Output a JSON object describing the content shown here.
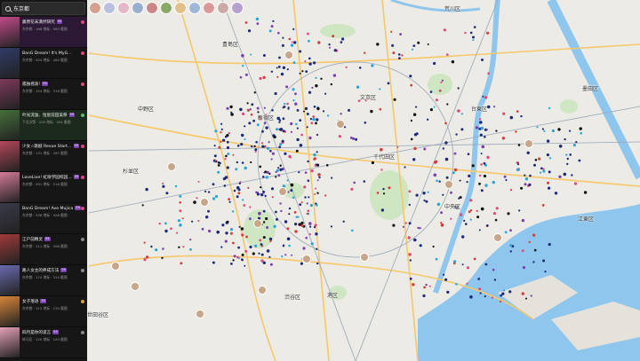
{
  "search": {
    "value": "东京都",
    "icon": "search-icon"
  },
  "list": [
    {
      "title": "藤原花未満然研究",
      "badge": "55",
      "sub": "东京都 · 166 地标 · 583 截图",
      "color": "#c24a8a",
      "dot": "#e0487a",
      "state": "active"
    },
    {
      "title": "BanG Dream! It's MyG…",
      "badge": "",
      "sub": "东京都 · 454 地标 · 484 截图",
      "color": "#2f3b66",
      "dot": "#e0487a",
      "state": ""
    },
    {
      "title": "孤独摇滚!",
      "badge": "55",
      "sub": "东京都 · 154 地标 · 318 截图",
      "color": "#7d3a5a",
      "dot": "#e0487a",
      "state": ""
    },
    {
      "title": "叶光流溢、恒星前田美祭",
      "badge": "55",
      "sub": "下北沢等 · 200 地标 · 254 截图",
      "color": "#456f3a",
      "dot": "#5fbf6a",
      "state": "green"
    },
    {
      "title": "少女☆歌剧 Revue Start…",
      "badge": "55",
      "sub": "东京都 · 131 地标 · 287 截图",
      "color": "#b5475a",
      "dot": "#e0487a",
      "state": ""
    },
    {
      "title": "LoveLive! 虹咲学园校园…",
      "badge": "55",
      "sub": "东京都 · 261 地标 · 518 截图",
      "color": "#d47b9a",
      "dot": "#e0487a",
      "state": ""
    },
    {
      "title": "BanG Dream! Ave Mujica",
      "badge": "55",
      "sub": "东京都 · 336 地标 · 426 截图",
      "color": "#3a3a4a",
      "dot": "#e0487a",
      "state": ""
    },
    {
      "title": "江户前精灵",
      "badge": "55",
      "sub": "东京都 · 111 地标 · 306 截图",
      "color": "#a13a3a",
      "dot": "#888888",
      "state": ""
    },
    {
      "title": "路人女主的养成方法",
      "badge": "55",
      "sub": "东京都 · 174 地标 · 314 截图",
      "color": "#6a6ab0",
      "dot": "#888888",
      "state": ""
    },
    {
      "title": "女子落语",
      "badge": "55",
      "sub": "东京都 · 113 地标 · 130 截图",
      "color": "#d9863a",
      "dot": "#d9a23a",
      "state": ""
    },
    {
      "title": "四月是你的谎言",
      "badge": "55",
      "sub": "练马区 · 120 地标 · 163 截图",
      "color": "#e4a0b8",
      "dot": "#888888",
      "state": ""
    }
  ],
  "topbar_avatars": [
    "#d5a090",
    "#b9c0e0",
    "#e6b7c9",
    "#9ab0d0",
    "#c88",
    "#8a6",
    "#e3c08a",
    "#a0b8d8",
    "#d99",
    "#caa",
    "#b8a0d0"
  ],
  "map_labels": [
    {
      "text": "荒川区",
      "kind": ""
    },
    {
      "text": "豊島区",
      "kind": ""
    },
    {
      "text": "文京区",
      "kind": ""
    },
    {
      "text": "台東区",
      "kind": ""
    },
    {
      "text": "墨田区",
      "kind": ""
    },
    {
      "text": "中野区",
      "kind": ""
    },
    {
      "text": "新宿区",
      "kind": ""
    },
    {
      "text": "杉並区",
      "kind": ""
    },
    {
      "text": "千代田区",
      "kind": ""
    },
    {
      "text": "中央区",
      "kind": ""
    },
    {
      "text": "江東区",
      "kind": ""
    },
    {
      "text": "渋谷区",
      "kind": ""
    },
    {
      "text": "港区",
      "kind": ""
    },
    {
      "text": "世田谷区",
      "kind": ""
    }
  ],
  "colors": {
    "map_bg": "#eceae4",
    "water": "#8fc3ea",
    "park": "#cfe6c2",
    "sidebar_bg": "#161616"
  }
}
